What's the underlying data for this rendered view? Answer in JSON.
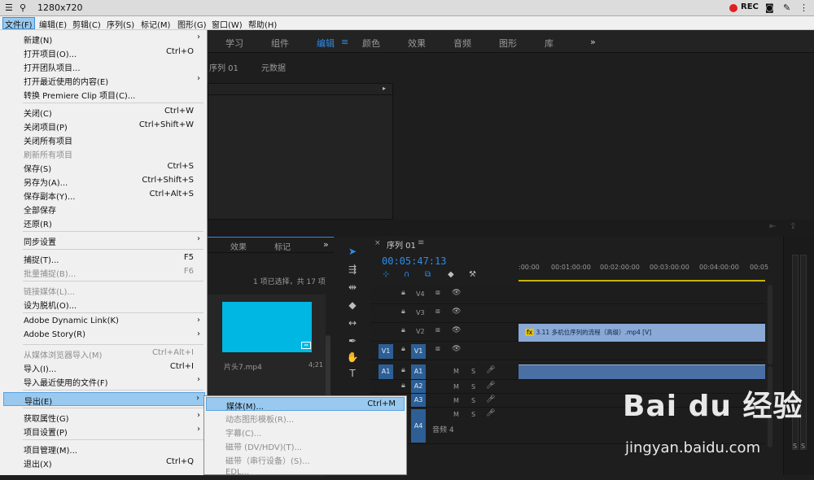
{
  "recorder": {
    "title": "1280x720",
    "rec_label": "REC"
  },
  "menubar": {
    "items": [
      "文件(F)",
      "编辑(E)",
      "剪辑(C)",
      "序列(S)",
      "标记(M)",
      "图形(G)",
      "窗口(W)",
      "帮助(H)"
    ]
  },
  "workspaces": {
    "tabs": [
      "学习",
      "组件",
      "编辑",
      "颜色",
      "效果",
      "音频",
      "图形",
      "库"
    ],
    "active": "编辑",
    "more": "»"
  },
  "source": {
    "tabs": [
      "序列 01",
      "元数据"
    ]
  },
  "project": {
    "tabs": [
      "效果",
      "标记"
    ],
    "status": "1 项已选择，共 17 项",
    "clip_name": "片头7.mp4",
    "clip_duration": "4;21"
  },
  "file_menu": {
    "items": [
      {
        "label": "新建(N)",
        "shortcut": "",
        "submenu": true,
        "disabled": false
      },
      {
        "label": "打开项目(O)...",
        "shortcut": "Ctrl+O",
        "submenu": false,
        "disabled": false
      },
      {
        "label": "打开团队项目...",
        "shortcut": "",
        "submenu": false,
        "disabled": false
      },
      {
        "label": "打开最近使用的内容(E)",
        "shortcut": "",
        "submenu": true,
        "disabled": false
      },
      {
        "label": "转换 Premiere Clip 项目(C)...",
        "shortcut": "",
        "submenu": false,
        "disabled": false
      },
      {
        "label": "关闭(C)",
        "shortcut": "Ctrl+W",
        "submenu": false,
        "disabled": false
      },
      {
        "label": "关闭项目(P)",
        "shortcut": "Ctrl+Shift+W",
        "submenu": false,
        "disabled": false
      },
      {
        "label": "关闭所有项目",
        "shortcut": "",
        "submenu": false,
        "disabled": false
      },
      {
        "label": "刷新所有项目",
        "shortcut": "",
        "submenu": false,
        "disabled": true
      },
      {
        "label": "保存(S)",
        "shortcut": "Ctrl+S",
        "submenu": false,
        "disabled": false
      },
      {
        "label": "另存为(A)...",
        "shortcut": "Ctrl+Shift+S",
        "submenu": false,
        "disabled": false
      },
      {
        "label": "保存副本(Y)...",
        "shortcut": "Ctrl+Alt+S",
        "submenu": false,
        "disabled": false
      },
      {
        "label": "全部保存",
        "shortcut": "",
        "submenu": false,
        "disabled": false
      },
      {
        "label": "还原(R)",
        "shortcut": "",
        "submenu": false,
        "disabled": false
      },
      {
        "label": "同步设置",
        "shortcut": "",
        "submenu": true,
        "disabled": false
      },
      {
        "label": "捕捉(T)...",
        "shortcut": "F5",
        "submenu": false,
        "disabled": false
      },
      {
        "label": "批量捕捉(B)...",
        "shortcut": "F6",
        "submenu": false,
        "disabled": true
      },
      {
        "label": "链接媒体(L)...",
        "shortcut": "",
        "submenu": false,
        "disabled": true
      },
      {
        "label": "设为脱机(O)...",
        "shortcut": "",
        "submenu": false,
        "disabled": false
      },
      {
        "label": "Adobe Dynamic Link(K)",
        "shortcut": "",
        "submenu": true,
        "disabled": false
      },
      {
        "label": "Adobe Story(R)",
        "shortcut": "",
        "submenu": true,
        "disabled": false
      },
      {
        "label": "从媒体浏览器导入(M)",
        "shortcut": "Ctrl+Alt+I",
        "submenu": false,
        "disabled": true
      },
      {
        "label": "导入(I)...",
        "shortcut": "Ctrl+I",
        "submenu": false,
        "disabled": false
      },
      {
        "label": "导入最近使用的文件(F)",
        "shortcut": "",
        "submenu": true,
        "disabled": false
      },
      {
        "label": "导出(E)",
        "shortcut": "",
        "submenu": true,
        "disabled": false,
        "highlighted": true
      },
      {
        "label": "获取属性(G)",
        "shortcut": "",
        "submenu": true,
        "disabled": false
      },
      {
        "label": "项目设置(P)",
        "shortcut": "",
        "submenu": true,
        "disabled": false
      },
      {
        "label": "项目管理(M)...",
        "shortcut": "",
        "submenu": false,
        "disabled": false
      },
      {
        "label": "退出(X)",
        "shortcut": "Ctrl+Q",
        "submenu": false,
        "disabled": false
      }
    ]
  },
  "export_submenu": {
    "items": [
      {
        "label": "媒体(M)...",
        "shortcut": "Ctrl+M",
        "disabled": false,
        "highlighted": true
      },
      {
        "label": "动态图形模板(R)...",
        "shortcut": "",
        "disabled": true
      },
      {
        "label": "字幕(C)...",
        "shortcut": "",
        "disabled": true
      },
      {
        "label": "磁带 (DV/HDV)(T)...",
        "shortcut": "",
        "disabled": true
      },
      {
        "label": "磁带（串行设备）(S)...",
        "shortcut": "",
        "disabled": true
      },
      {
        "label": "EDL...",
        "shortcut": "",
        "disabled": true
      }
    ]
  },
  "timeline": {
    "title": "序列 01",
    "timecode": "00:05:47:13",
    "ruler": [
      ":00:00",
      "00:01:00:00",
      "00:02:00:00",
      "00:03:00:00",
      "00:04:00:00",
      "00:05"
    ],
    "video_tracks": [
      "V4",
      "V3",
      "V2",
      "V1"
    ],
    "audio_tracks": [
      "A1",
      "A2",
      "A3",
      "A4"
    ],
    "source_video": "V1",
    "source_audio": "A1",
    "m_label": "M",
    "s_label": "S",
    "audio4_name": "音频 4",
    "clip_label": "3.11 多机位序列的流程（高级）.mp4 [V]",
    "fx_label": "fx",
    "meter_labels": [
      "S",
      "S"
    ]
  },
  "watermark": {
    "logo": "Bai du 经验",
    "url": "jingyan.baidu.com"
  },
  "colors": {
    "accent": "#2d8ceb",
    "menu_highlight": "#99c9ef",
    "track_button": "#2d5f95",
    "clip_video": "#8aa9d6",
    "thumb": "#00b7e3"
  }
}
